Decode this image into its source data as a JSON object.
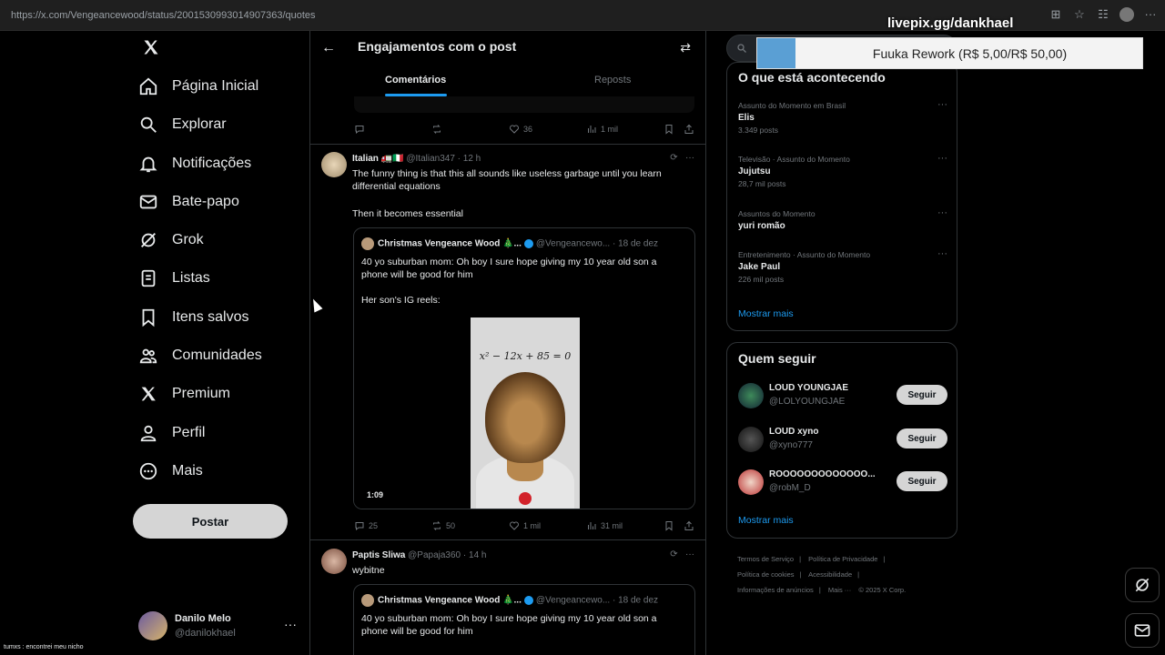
{
  "browser": {
    "url": "https://x.com/Vengeancewood/status/2001530993014907363/quotes"
  },
  "overlay": {
    "livepix": "livepix.gg/dankhael",
    "donation_text": "Fuuka Rework (R$ 5,00/R$ 50,00)",
    "donation_progress": 0.1,
    "footer_note": "tumxs : encontrei meu nicho"
  },
  "nav": {
    "items": [
      {
        "label": "Página Inicial"
      },
      {
        "label": "Explorar"
      },
      {
        "label": "Notificações"
      },
      {
        "label": "Bate-papo"
      },
      {
        "label": "Grok"
      },
      {
        "label": "Listas"
      },
      {
        "label": "Itens salvos"
      },
      {
        "label": "Comunidades"
      },
      {
        "label": "Premium"
      },
      {
        "label": "Perfil"
      },
      {
        "label": "Mais"
      }
    ],
    "post_button": "Postar",
    "user": {
      "name": "Danilo Melo",
      "handle": "@danilokhael",
      "more": "···"
    }
  },
  "header": {
    "title": "Engajamentos com o post",
    "tabs": [
      {
        "label": "Comentários"
      },
      {
        "label": "Reposts"
      }
    ]
  },
  "top_actions": {
    "replies": "",
    "reposts": "",
    "likes": "36",
    "views": "1 mil"
  },
  "tweets": [
    {
      "name": "Italian 🚛🇮🇹",
      "handle": "@Italian347 · 12 h",
      "text1": "The funny thing is that this all sounds like useless garbage until you learn differential equations",
      "text2": "Then it becomes essential",
      "quote": {
        "name": "Christmas Vengeance Wood 🎄...",
        "meta": "@Vengeancewo... · 18 de dez",
        "text1": "40 yo suburban mom: Oh boy I sure hope giving my 10 year old son a phone will be good for him",
        "text2": "Her son's IG reels:",
        "equation": "x² − 12x + 85 = 0",
        "duration": "1:09"
      },
      "actions": {
        "replies": "25",
        "reposts": "50",
        "likes": "1 mil",
        "views": "31 mil"
      }
    },
    {
      "name": "Paptis Sliwa",
      "handle": "@Papaja360 · 14 h",
      "text1": "wybitne",
      "quote": {
        "name": "Christmas Vengeance Wood 🎄...",
        "meta": "@Vengeancewo... · 18 de dez",
        "text1": "40 yo suburban mom: Oh boy I sure hope giving my 10 year old son a phone will be good for him"
      }
    }
  ],
  "right": {
    "search_placeholder": "Buscar",
    "trends_title": "O que está acontecendo",
    "trends": [
      {
        "context": "Assunto do Momento em Brasil",
        "topic": "Elis",
        "count": "3.349 posts"
      },
      {
        "context": "Televisão · Assunto do Momento",
        "topic": "Jujutsu",
        "count": "28,7 mil posts"
      },
      {
        "context": "Assuntos do Momento",
        "topic": "yuri romão",
        "count": ""
      },
      {
        "context": "Entretenimento · Assunto do Momento",
        "topic": "Jake Paul",
        "count": "226 mil posts"
      }
    ],
    "show_more": "Mostrar mais",
    "who_title": "Quem seguir",
    "who": [
      {
        "name": "LOUD YOUNGJAE",
        "handle": "@LOLYOUNGJAE",
        "button": "Seguir"
      },
      {
        "name": "LOUD xyno",
        "handle": "@xyno777",
        "button": "Seguir"
      },
      {
        "name": "ROOOOOOOOOOOOO...",
        "handle": "@robM_D",
        "button": "Seguir"
      }
    ],
    "footer": [
      "Termos de Serviço",
      "|",
      "Política de Privacidade",
      "|",
      "Política de cookies",
      "|",
      "Acessibilidade",
      "|",
      "Informações de anúncios",
      "|",
      "Mais ···",
      "© 2025 X Corp."
    ]
  }
}
